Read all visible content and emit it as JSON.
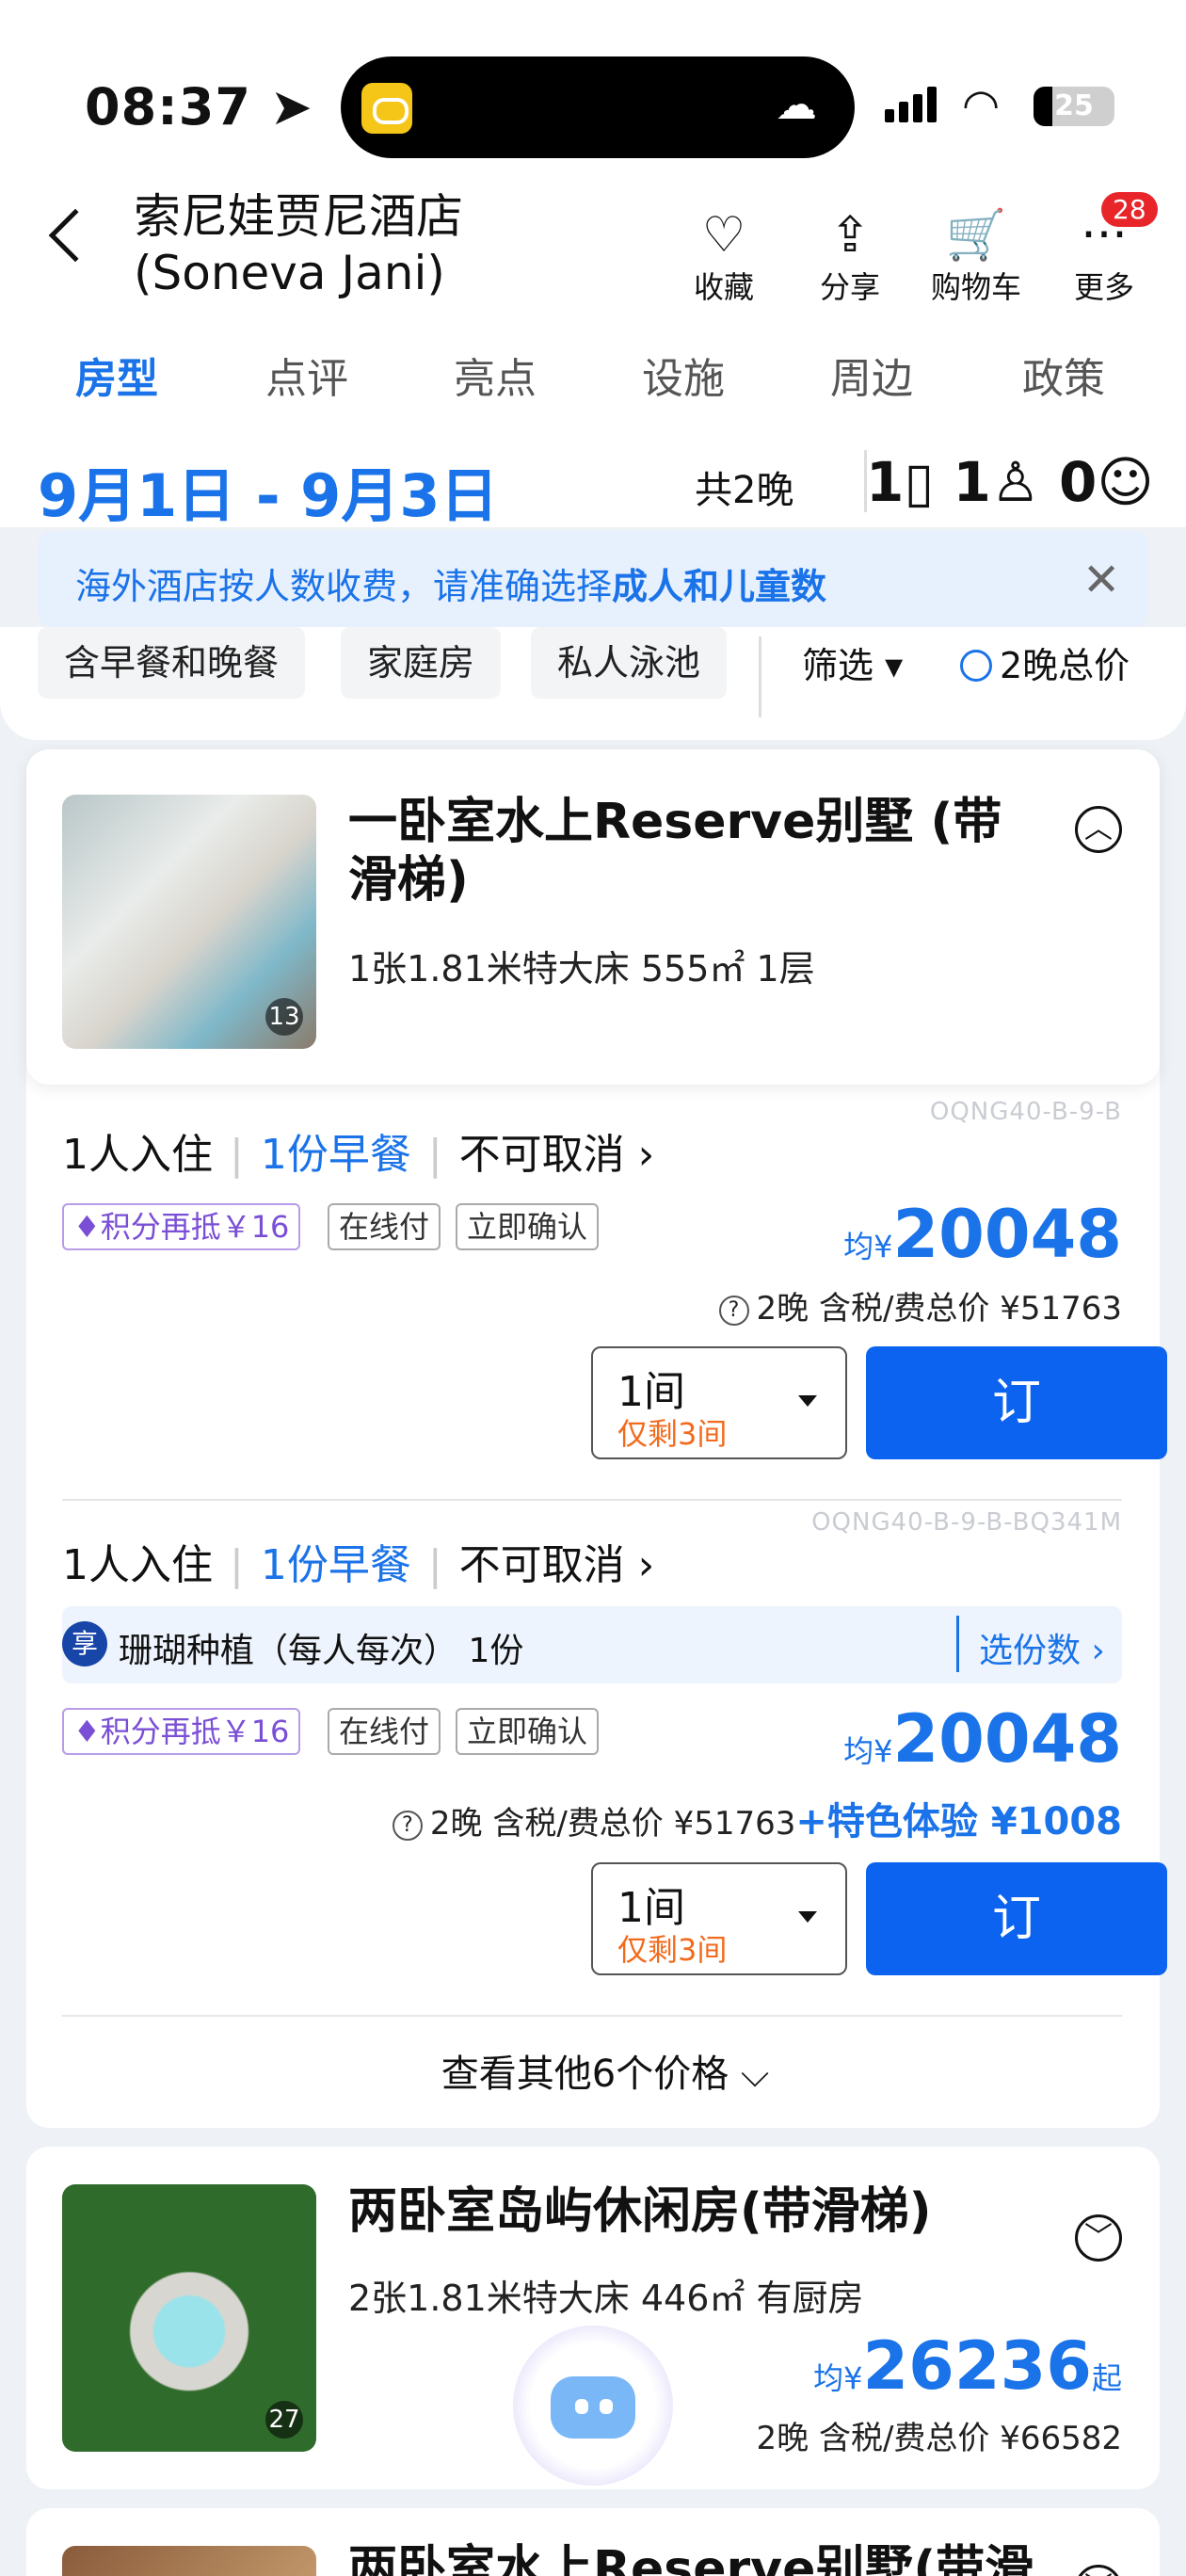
{
  "status": {
    "time": "08:37",
    "battery": "25"
  },
  "header": {
    "title_line1": "索尼娃贾尼酒店",
    "title_line2": "(Soneva Jani)",
    "actions": [
      {
        "label": "收藏",
        "icon": "heart-icon"
      },
      {
        "label": "分享",
        "icon": "share-icon"
      },
      {
        "label": "购物车",
        "icon": "cart-icon"
      },
      {
        "label": "更多",
        "icon": "more-icon"
      }
    ],
    "more_badge": "28"
  },
  "tabs": [
    "房型",
    "点评",
    "亮点",
    "设施",
    "周边",
    "政策"
  ],
  "dates": {
    "range": "9月1日 - 9月3日",
    "nights": "共2晚",
    "rooms": "1",
    "adults": "1",
    "children": "0"
  },
  "notice": {
    "text": "海外酒店按人数收费，请准确选择",
    "bold": "成人和儿童数"
  },
  "filters": {
    "chips": [
      "含早餐和晚餐",
      "家庭房",
      "私人泳池"
    ],
    "filter_label": "筛选",
    "total_label": "2晚总价"
  },
  "room1": {
    "title": "一卧室水上Reserve别墅 (带滑梯)",
    "desc": "1张1.81米特大床  555㎡  1层",
    "photo_count": "13",
    "plans": [
      {
        "code": "OQNG40-B-9-B",
        "guests": "1人入住",
        "meal": "1份早餐",
        "cancel": "不可取消",
        "tags": [
          "积分再抵￥16",
          "在线付",
          "立即确认"
        ],
        "price_prefix": "均¥",
        "price": "20048",
        "total": "2晚 含税/费总价 ¥51763",
        "qty": "1间",
        "left": "仅剩3间",
        "book": "订"
      },
      {
        "code": "OQNG40-B-9-B-BQ341M",
        "guests": "1人入住",
        "meal": "1份早餐",
        "cancel": "不可取消",
        "addon": "珊瑚种植（每人每次） 1份",
        "addon_badge": "享",
        "addon_action": "选份数",
        "tags": [
          "积分再抵￥16",
          "在线付",
          "立即确认"
        ],
        "price_prefix": "均¥",
        "price": "20048",
        "total": "2晚 含税/费总价 ¥51763",
        "extra": "+特色体验 ¥1008",
        "qty": "1间",
        "left": "仅剩3间",
        "book": "订"
      }
    ],
    "more_prices": "查看其他6个价格"
  },
  "room2": {
    "title": "两卧室岛屿休闲房(带滑梯)",
    "desc": "2张1.81米特大床  446㎡  有厨房",
    "photo_count": "27",
    "price_prefix": "均¥",
    "price": "26236",
    "price_suffix": "起",
    "total": "2晚 含税/费总价 ¥66582"
  },
  "room3": {
    "title": "两卧室水上Reserve别墅(带滑"
  }
}
